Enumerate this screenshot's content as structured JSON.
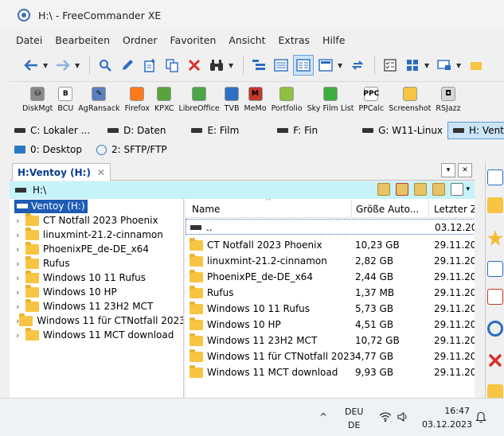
{
  "window": {
    "title": "H:\\ - FreeCommander XE"
  },
  "menu": [
    "Datei",
    "Bearbeiten",
    "Ordner",
    "Favoriten",
    "Ansicht",
    "Extras",
    "Hilfe"
  ],
  "toolbar_icons": [
    "back-arrow-icon",
    "forward-arrow-icon",
    "search-icon",
    "edit-icon",
    "new-folder-icon",
    "copy-icon",
    "delete-icon",
    "binoculars-icon",
    "tree-view-icon",
    "details-view-icon",
    "list-view-icon",
    "preview-view-icon",
    "sync-icon",
    "checklist-icon",
    "grid-icon",
    "screen-icon"
  ],
  "apps": [
    {
      "label": "DiskMgt",
      "color": "#8a8a8a",
      "glyph": "⛁"
    },
    {
      "label": "BCU",
      "color": "#ffffff",
      "glyph": "B"
    },
    {
      "label": "AgRansack",
      "color": "#5b7fbf",
      "glyph": "✎"
    },
    {
      "label": "Firefox",
      "color": "#ff7a1a",
      "glyph": ""
    },
    {
      "label": "KPXC",
      "color": "#5aa23a",
      "glyph": ""
    },
    {
      "label": "LibreOffice",
      "color": "#4aa646",
      "glyph": ""
    },
    {
      "label": "TVB",
      "color": "#2f6fc4",
      "glyph": ""
    },
    {
      "label": "MeMo",
      "color": "#c0392b",
      "glyph": "M"
    },
    {
      "label": "Portfolio",
      "color": "#8fc042",
      "glyph": ""
    },
    {
      "label": "Sky Film List",
      "color": "#3fae3f",
      "glyph": ""
    },
    {
      "label": "PPCalc",
      "color": "#ffffff",
      "glyph": "PPC"
    },
    {
      "label": "Screenshot",
      "color": "#f7c543",
      "glyph": ""
    },
    {
      "label": "RSJazz",
      "color": "#d7d7d7",
      "glyph": "◘"
    }
  ],
  "drives_row1": [
    "C: Lokaler ...",
    "D: Daten",
    "E: Film",
    "F: Fin",
    "G: W11-Linux",
    "H: Ventoy"
  ],
  "drives_row2": [
    "0: Desktop",
    "2: SFTP/FTP"
  ],
  "active_drive": "H: Ventoy",
  "panel": {
    "tab_label": "H:Ventoy (H:)",
    "tab_close": "✕",
    "path": "H:\\",
    "menu_glyph": "▾",
    "close_glyph": "✕"
  },
  "tree": {
    "root": "Ventoy (H:)",
    "items": [
      "CT Notfall 2023 Phoenix",
      "linuxmint-21.2-cinnamon",
      "PhoenixPE_de-DE_x64",
      "Rufus",
      "Windows 10 11 Rufus",
      "Windows 10 HP",
      "Windows 11 23H2 MCT",
      "Windows 11 für CTNotfall 2023",
      "Windows 11 MCT download"
    ]
  },
  "filelist": {
    "columns": {
      "name": "Name",
      "size": "Größe Auto...",
      "date": "Letzter Z"
    },
    "updir": {
      "name": "..",
      "date": "03.12.20"
    },
    "rows": [
      {
        "name": "CT Notfall 2023 Phoenix",
        "size": "10,23 GB",
        "date": "29.11.20"
      },
      {
        "name": "linuxmint-21.2-cinnamon",
        "size": "2,82 GB",
        "date": "29.11.20"
      },
      {
        "name": "PhoenixPE_de-DE_x64",
        "size": "2,44 GB",
        "date": "29.11.20"
      },
      {
        "name": "Rufus",
        "size": "1,37 MB",
        "date": "29.11.20"
      },
      {
        "name": "Windows 10 11 Rufus",
        "size": "5,73 GB",
        "date": "29.11.20"
      },
      {
        "name": "Windows 10 HP",
        "size": "4,51 GB",
        "date": "29.11.20"
      },
      {
        "name": "Windows 11 23H2 MCT",
        "size": "10,72 GB",
        "date": "29.11.20"
      },
      {
        "name": "Windows 11 für CTNotfall 2023",
        "size": "4,77 GB",
        "date": "29.11.20"
      },
      {
        "name": "Windows 11 MCT download",
        "size": "9,93 GB",
        "date": "29.11.20"
      }
    ]
  },
  "taskbar": {
    "lang_top": "DEU",
    "lang_bottom": "DE",
    "time": "16:47",
    "date": "03.12.2023",
    "chevron": "^"
  }
}
